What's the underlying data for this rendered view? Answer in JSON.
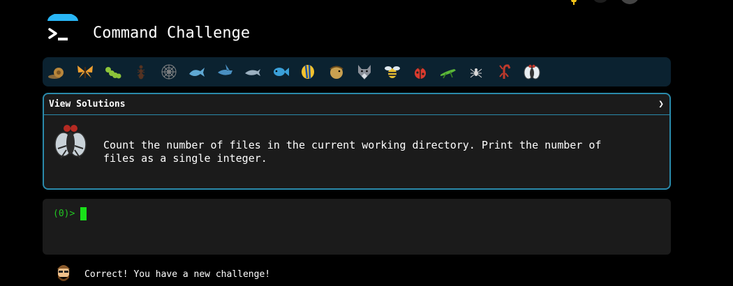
{
  "app": {
    "title": "Command Challenge"
  },
  "icon_bar": {
    "items": [
      {
        "name": "snail-icon"
      },
      {
        "name": "butterfly-icon"
      },
      {
        "name": "caterpillar-icon"
      },
      {
        "name": "ant-icon"
      },
      {
        "name": "spider-web-icon"
      },
      {
        "name": "whale-icon"
      },
      {
        "name": "shark-icon"
      },
      {
        "name": "dolphin-icon"
      },
      {
        "name": "fish-icon"
      },
      {
        "name": "tropical-fish-icon"
      },
      {
        "name": "pufferfish-icon"
      },
      {
        "name": "wolf-icon"
      },
      {
        "name": "bee-icon"
      },
      {
        "name": "ladybug-icon"
      },
      {
        "name": "cricket-icon"
      },
      {
        "name": "spider-icon"
      },
      {
        "name": "scorpion-icon"
      },
      {
        "name": "fly-icon"
      }
    ]
  },
  "challenge": {
    "solutions_label": "View Solutions",
    "chevron": "❯",
    "description": "Count the number of files in the current working directory. Print the number of files as a single integer."
  },
  "terminal": {
    "prompt": "(0)>"
  },
  "feedback": {
    "message": "Correct! You have a new challenge!"
  },
  "colors": {
    "accent": "#2a8aab",
    "prompt_green": "#22c622",
    "icon_bar_bg": "#0b2230"
  }
}
